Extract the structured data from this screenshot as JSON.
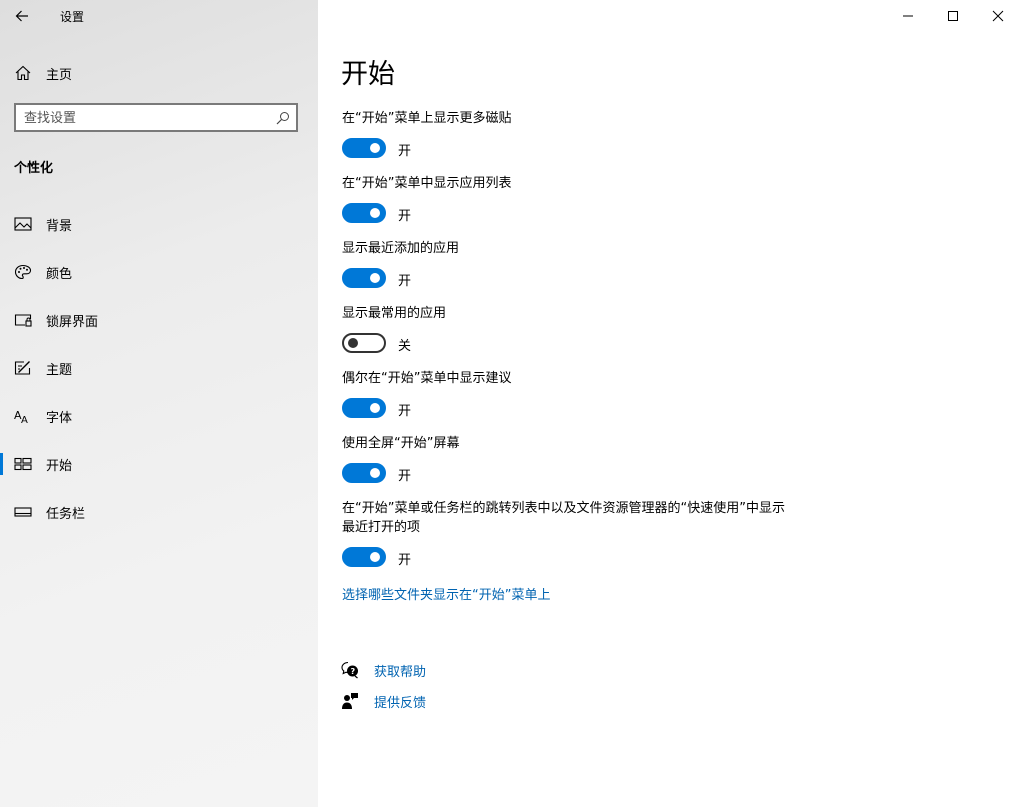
{
  "app": {
    "title": "设置"
  },
  "sidebar": {
    "home_label": "主页",
    "search_placeholder": "查找设置",
    "section_title": "个性化",
    "items": [
      {
        "label": "背景",
        "icon": "picture-icon"
      },
      {
        "label": "颜色",
        "icon": "palette-icon"
      },
      {
        "label": "锁屏界面",
        "icon": "lock-screen-icon"
      },
      {
        "label": "主题",
        "icon": "theme-icon"
      },
      {
        "label": "字体",
        "icon": "font-icon"
      },
      {
        "label": "开始",
        "icon": "start-icon",
        "active": true
      },
      {
        "label": "任务栏",
        "icon": "taskbar-icon"
      }
    ]
  },
  "main": {
    "title": "开始",
    "settings": [
      {
        "label": "在“开始”菜单上显示更多磁贴",
        "on": true,
        "state": "开"
      },
      {
        "label": "在“开始”菜单中显示应用列表",
        "on": true,
        "state": "开"
      },
      {
        "label": "显示最近添加的应用",
        "on": true,
        "state": "开"
      },
      {
        "label": "显示最常用的应用",
        "on": false,
        "state": "关"
      },
      {
        "label": "偶尔在“开始”菜单中显示建议",
        "on": true,
        "state": "开"
      },
      {
        "label": "使用全屏“开始”屏幕",
        "on": true,
        "state": "开"
      },
      {
        "label": "在“开始”菜单或任务栏的跳转列表中以及文件资源管理器的“快速使用”中显示最近打开的项",
        "on": true,
        "state": "开"
      }
    ],
    "folders_link": "选择哪些文件夹显示在“开始”菜单上",
    "get_help": "获取帮助",
    "give_feedback": "提供反馈"
  },
  "colors": {
    "accent": "#0078d7",
    "link": "#0063b1"
  }
}
